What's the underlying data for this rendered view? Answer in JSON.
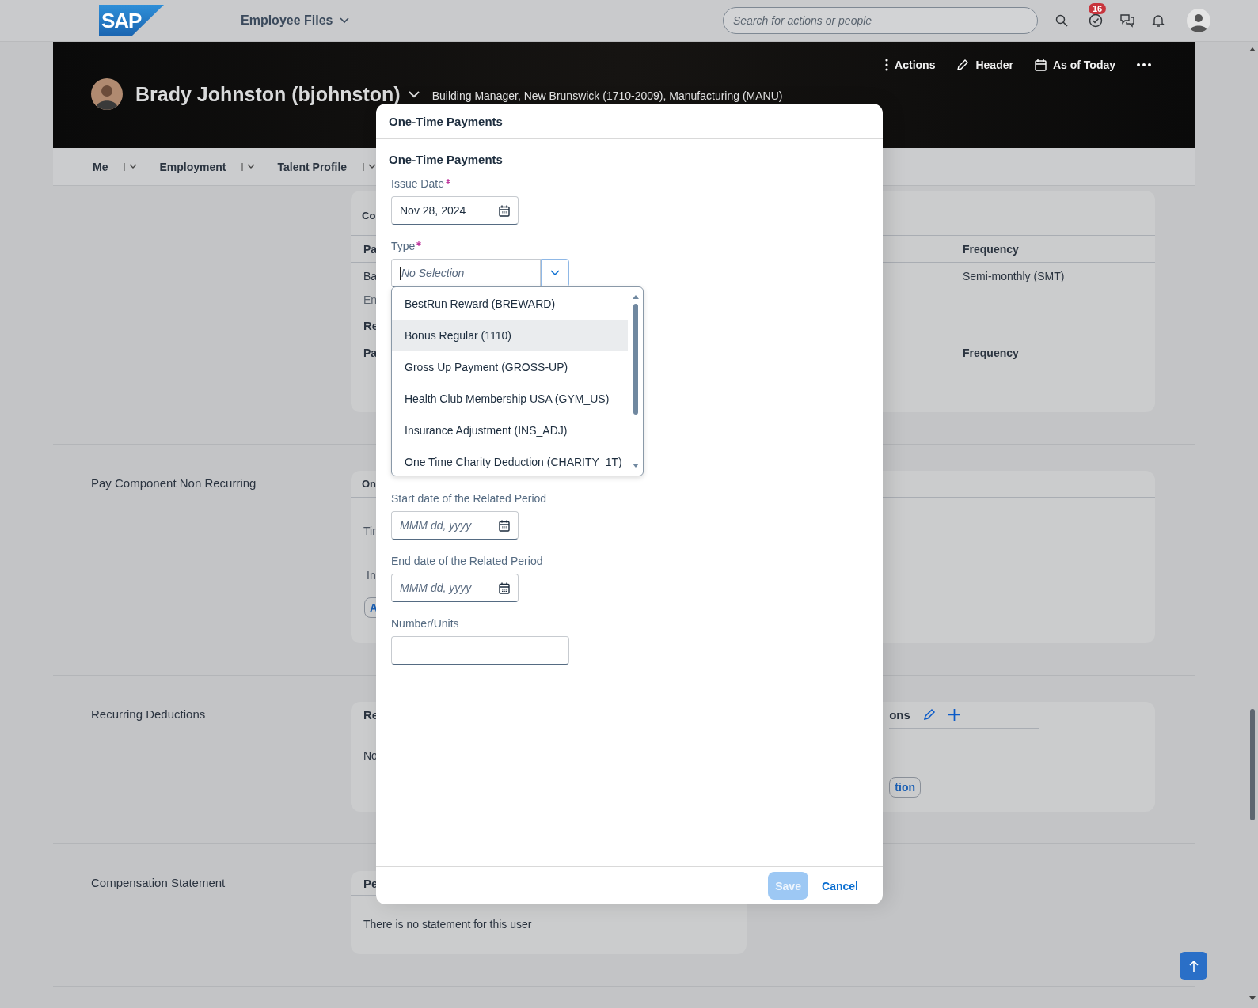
{
  "shell": {
    "logo": "SAP",
    "title": "Employee Files",
    "search_placeholder": "Search for actions or people",
    "badge": "16"
  },
  "header": {
    "name": "Brady Johnston (bjohnston)",
    "subtitle": "Building Manager, New Brunswick (1710-2009), Manufacturing (MANU)",
    "actions": [
      {
        "kind": "kebab",
        "label": "Actions"
      },
      {
        "kind": "pencil",
        "label": "Header"
      },
      {
        "kind": "calendar",
        "label": "As of Today"
      },
      {
        "kind": "more"
      }
    ]
  },
  "tabs": [
    {
      "label": "Me",
      "selected": false
    },
    {
      "label": "Employment",
      "selected": false
    },
    {
      "label": "Talent Profile",
      "selected": false
    }
  ],
  "compensation": {
    "title": "Co",
    "columns": [
      "Pa",
      "Frequency"
    ],
    "row": [
      "Ba",
      "Semi-monthly (SMT)"
    ],
    "note": "En",
    "subtitle": "Re",
    "columns_2": [
      "Pa",
      "Frequency"
    ]
  },
  "non_recurring": {
    "label": "Pay Component Non Recurring",
    "card_title": "On",
    "lines": [
      "Tir",
      "In"
    ],
    "button": "A"
  },
  "deductions": {
    "label": "Recurring Deductions",
    "card_title": "Re",
    "card_title_right": "ons",
    "text": "No",
    "button": "tion"
  },
  "statement": {
    "label": "Compensation Statement",
    "card_title": "Pe",
    "text": "There is no statement for this user"
  },
  "dialog": {
    "title": "One-Time Payments",
    "heading": "One-Time Payments",
    "fields": [
      {
        "kind": "date",
        "label": "Issue Date",
        "required": true,
        "value": "Nov 28, 2024"
      },
      {
        "kind": "select",
        "label": "Type",
        "required": true,
        "placeholder": "No Selection",
        "options": [
          {
            "label": "BestRun Reward (BREWARD)",
            "selected": false
          },
          {
            "label": "Bonus Regular (1110)",
            "selected": true
          },
          {
            "label": "Gross Up Payment (GROSS-UP)",
            "selected": false
          },
          {
            "label": "Health Club Membership USA (GYM_US)",
            "selected": false
          },
          {
            "label": "Insurance Adjustment (INS_ADJ)",
            "selected": false
          },
          {
            "label": "One Time Charity Deduction (CHARITY_1T)",
            "selected": false
          }
        ]
      },
      {
        "kind": "date",
        "label": "Start date of the Related Period",
        "required": false,
        "placeholder": "MMM dd, yyyy"
      },
      {
        "kind": "date",
        "label": "End date of the Related Period",
        "required": false,
        "placeholder": "MMM dd, yyyy"
      },
      {
        "kind": "number",
        "label": "Number/Units",
        "required": false
      }
    ],
    "save": {
      "label": "Save",
      "disabled": true
    },
    "cancel": "Cancel"
  }
}
